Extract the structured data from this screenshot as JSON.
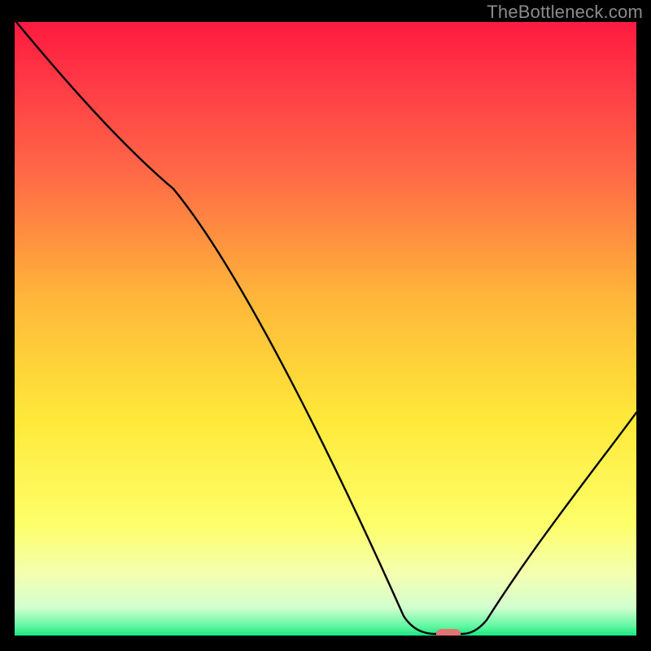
{
  "watermark": "TheBottleneck.com",
  "chart_data": {
    "type": "line",
    "title": "",
    "xlabel": "",
    "ylabel": "",
    "xlim": [
      0,
      100
    ],
    "ylim": [
      0,
      100
    ],
    "x": [
      0,
      25,
      63,
      68,
      72,
      100
    ],
    "y": [
      100,
      73,
      2,
      0,
      0,
      36
    ],
    "curve_note": "V-shaped bottleneck curve: steep descent with slight inflection ~x=25, flat minimum ~x=63-72, rise to ~36 at x=100",
    "marker": {
      "x": 70,
      "y": 0,
      "color": "#e57373",
      "shape": "rounded-rect"
    },
    "background_gradient": {
      "stops": [
        {
          "pos": 0.0,
          "color": "#ff1a3f"
        },
        {
          "pos": 0.1,
          "color": "#ff3a46"
        },
        {
          "pos": 0.25,
          "color": "#ff6a46"
        },
        {
          "pos": 0.45,
          "color": "#ffb63a"
        },
        {
          "pos": 0.65,
          "color": "#ffe93a"
        },
        {
          "pos": 0.82,
          "color": "#fdff6a"
        },
        {
          "pos": 0.9,
          "color": "#f4ffb0"
        },
        {
          "pos": 0.955,
          "color": "#d2ffcf"
        },
        {
          "pos": 0.985,
          "color": "#60f7a0"
        },
        {
          "pos": 1.0,
          "color": "#17e880"
        }
      ]
    }
  }
}
